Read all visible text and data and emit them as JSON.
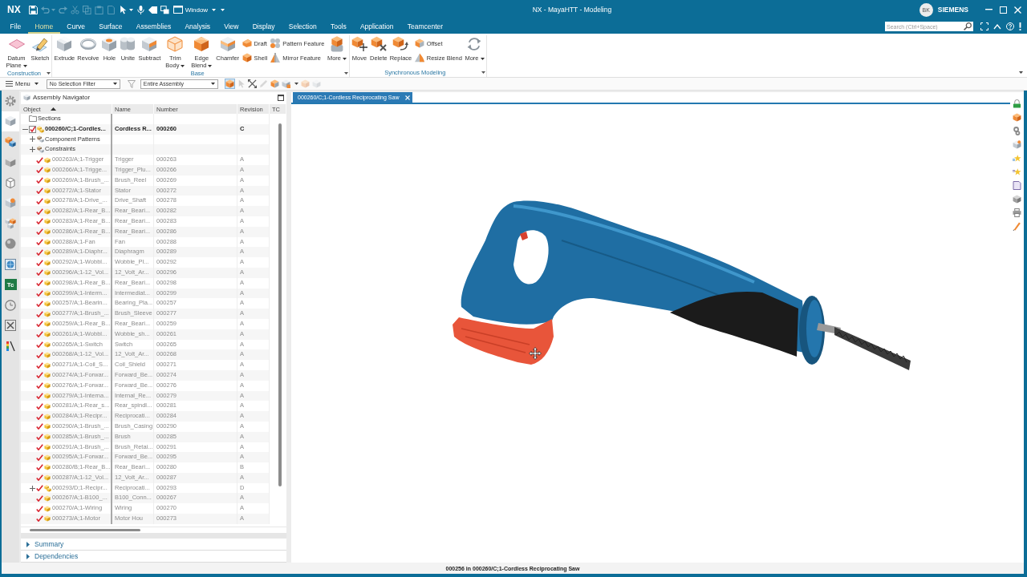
{
  "title_bar": {
    "logo": "NX",
    "quick_access": [
      {
        "disabled": false,
        "dropdown": false
      },
      {
        "disabled": true,
        "dropdown": true
      },
      {
        "disabled": true,
        "dropdown": false
      },
      {
        "disabled": true,
        "dropdown": false
      },
      {
        "disabled": true,
        "dropdown": false
      },
      {
        "disabled": true,
        "dropdown": false
      },
      {
        "disabled": true,
        "dropdown": false
      },
      {
        "disabled": false,
        "dropdown": true
      },
      {
        "disabled": false,
        "dropdown": false
      },
      {
        "disabled": false,
        "dropdown": false
      },
      {
        "disabled": false,
        "dropdown": false
      }
    ],
    "window_menu": "Window",
    "title": "NX - MayaHTT - Modeling",
    "user_initials": "BK",
    "brand": "SIEMENS"
  },
  "menu_tabs": [
    {
      "label": "File",
      "selected": false
    },
    {
      "label": "Home",
      "selected": true
    },
    {
      "label": "Curve",
      "selected": false
    },
    {
      "label": "Surface",
      "selected": false
    },
    {
      "label": "Assemblies",
      "selected": false
    },
    {
      "label": "Analysis",
      "selected": false
    },
    {
      "label": "View",
      "selected": false
    },
    {
      "label": "Display",
      "selected": false
    },
    {
      "label": "Selection",
      "selected": false
    },
    {
      "label": "Tools",
      "selected": false
    },
    {
      "label": "Application",
      "selected": false
    },
    {
      "label": "Teamcenter",
      "selected": false
    }
  ],
  "search": {
    "placeholder": "Search (Ctrl+Space)"
  },
  "ribbon": {
    "groups": [
      {
        "label": "Construction",
        "commands": [
          {
            "kind": "large",
            "label": "Datum Plane",
            "dropdown": true
          },
          {
            "kind": "large",
            "label": "Sketch",
            "dropdown": false
          }
        ]
      },
      {
        "label": "Base",
        "commands": [
          {
            "kind": "large",
            "label": "Extrude",
            "dropdown": false
          },
          {
            "kind": "large",
            "label": "Revolve",
            "dropdown": false
          },
          {
            "kind": "large",
            "label": "Hole",
            "dropdown": false
          },
          {
            "kind": "large",
            "label": "Unite",
            "dropdown": false
          },
          {
            "kind": "large",
            "label": "Subtract",
            "dropdown": false
          },
          {
            "kind": "large",
            "label": "Trim Body",
            "dropdown": true
          },
          {
            "kind": "large",
            "label": "Edge Blend",
            "dropdown": true
          },
          {
            "kind": "large",
            "label": "Chamfer",
            "dropdown": false
          },
          {
            "kind": "stack",
            "items": [
              {
                "label": "Draft"
              },
              {
                "label": "Shell"
              }
            ]
          },
          {
            "kind": "stack",
            "items": [
              {
                "label": "Pattern Feature"
              },
              {
                "label": "Mirror Feature"
              }
            ]
          },
          {
            "kind": "large",
            "label": "More",
            "dropdown": true
          }
        ]
      },
      {
        "label": "Synchronous Modeling",
        "commands": [
          {
            "kind": "large",
            "label": "Move",
            "dropdown": false
          },
          {
            "kind": "large",
            "label": "Delete",
            "dropdown": false
          },
          {
            "kind": "large",
            "label": "Replace",
            "dropdown": false
          },
          {
            "kind": "stack",
            "items": [
              {
                "label": "Offset"
              },
              {
                "label": "Resize Blend"
              }
            ]
          },
          {
            "kind": "large",
            "label": "More",
            "dropdown": true
          }
        ]
      }
    ]
  },
  "toolbar": {
    "menu": "Menu",
    "selection_filter": "No Selection Filter",
    "scope": "Entire Assembly",
    "tools": [
      {
        "selected": true,
        "disabled": false
      },
      {
        "selected": false,
        "disabled": true
      },
      {
        "selected": false,
        "disabled": false
      },
      {
        "selected": false,
        "disabled": true
      },
      {
        "selected": false,
        "disabled": false
      },
      {
        "selected": false,
        "disabled": false
      },
      {
        "selected": false,
        "disabled": true
      },
      {
        "selected": false,
        "disabled": true
      }
    ]
  },
  "resource_bar": [
    {
      "kind": "icon",
      "selected": false
    },
    {
      "kind": "icon",
      "selected": true
    },
    {
      "kind": "icon",
      "selected": false
    },
    {
      "kind": "icon",
      "selected": false
    },
    {
      "kind": "icon",
      "selected": false
    },
    {
      "kind": "icon",
      "selected": false
    },
    {
      "kind": "icon",
      "selected": false
    },
    {
      "kind": "icon",
      "selected": false
    },
    {
      "kind": "icon",
      "selected": false
    },
    {
      "kind": "badge",
      "text": "Tc",
      "selected": false
    },
    {
      "kind": "icon",
      "selected": false
    },
    {
      "kind": "icon",
      "selected": false
    },
    {
      "kind": "icon",
      "selected": false
    }
  ],
  "navigator": {
    "title": "Assembly Navigator",
    "columns": [
      {
        "label": "Object",
        "sorted": true
      },
      {
        "label": "Name",
        "sorted": false
      },
      {
        "label": "Number",
        "sorted": false
      },
      {
        "label": "Revision",
        "sorted": false
      },
      {
        "label": "TC",
        "sorted": false
      }
    ],
    "tree": [
      {
        "kind": "folder",
        "object": "Sections"
      },
      {
        "kind": "assembly",
        "object": "000260/C;1-Cordles...",
        "name": "Cordless R...",
        "number": "000260",
        "revision": "C",
        "checked": true,
        "expanded": true,
        "children": [
          {
            "kind": "group",
            "object": "Component Patterns",
            "expanded": false
          },
          {
            "kind": "group",
            "object": "Constraints",
            "expanded": false
          },
          {
            "kind": "part",
            "object": "000263/A;1-Trigger",
            "name": "Trigger",
            "number": "000263",
            "revision": "A",
            "checked": true
          },
          {
            "kind": "part",
            "object": "000266/A;1-Trigge...",
            "name": "Trigger_Plu...",
            "number": "000266",
            "revision": "A",
            "checked": true
          },
          {
            "kind": "part",
            "object": "000269/A;1-Brush_...",
            "name": "Brush_Reel",
            "number": "000269",
            "revision": "A",
            "checked": true
          },
          {
            "kind": "part",
            "object": "000272/A;1-Stator",
            "name": "Stator",
            "number": "000272",
            "revision": "A",
            "checked": true
          },
          {
            "kind": "part",
            "object": "000278/A;1-Drive_...",
            "name": "Drive_Shaft",
            "number": "000278",
            "revision": "A",
            "checked": true
          },
          {
            "kind": "part",
            "object": "000282/A;1-Rear_B...",
            "name": "Rear_Beari...",
            "number": "000282",
            "revision": "A",
            "checked": true
          },
          {
            "kind": "part",
            "object": "000283/A;1-Rear_B...",
            "name": "Rear_Beari...",
            "number": "000283",
            "revision": "A",
            "checked": true
          },
          {
            "kind": "part",
            "object": "000286/A;1-Rear_B...",
            "name": "Rear_Beari...",
            "number": "000286",
            "revision": "A",
            "checked": true
          },
          {
            "kind": "part",
            "object": "000288/A;1-Fan",
            "name": "Fan",
            "number": "000288",
            "revision": "A",
            "checked": true
          },
          {
            "kind": "part",
            "object": "000289/A;1-Diaphr...",
            "name": "Diaphragm",
            "number": "000289",
            "revision": "A",
            "checked": true
          },
          {
            "kind": "part",
            "object": "000292/A;1-Wobbl...",
            "name": "Wobble_Pl...",
            "number": "000292",
            "revision": "A",
            "checked": true
          },
          {
            "kind": "part",
            "object": "000296/A;1-12_Vol...",
            "name": "12_Volt_Ar...",
            "number": "000296",
            "revision": "A",
            "checked": true
          },
          {
            "kind": "part",
            "object": "000298/A;1-Rear_B...",
            "name": "Rear_Beari...",
            "number": "000298",
            "revision": "A",
            "checked": true
          },
          {
            "kind": "part",
            "object": "000299/A;1-Interm...",
            "name": "Intermediat...",
            "number": "000299",
            "revision": "A",
            "checked": true
          },
          {
            "kind": "part",
            "object": "000257/A;1-Bearin...",
            "name": "Bearing_Pla...",
            "number": "000257",
            "revision": "A",
            "checked": true
          },
          {
            "kind": "part",
            "object": "000277/A;1-Brush_...",
            "name": "Brush_Sleeve",
            "number": "000277",
            "revision": "A",
            "checked": true
          },
          {
            "kind": "part",
            "object": "000259/A;1-Rear_B...",
            "name": "Rear_Beari...",
            "number": "000259",
            "revision": "A",
            "checked": true
          },
          {
            "kind": "part",
            "object": "000261/A;1-Wobbl...",
            "name": "Wobble_sh...",
            "number": "000261",
            "revision": "A",
            "checked": true
          },
          {
            "kind": "part",
            "object": "000265/A;1-Switch",
            "name": "Switch",
            "number": "000265",
            "revision": "A",
            "checked": true
          },
          {
            "kind": "part",
            "object": "000268/A;1-12_Vol...",
            "name": "12_Volt_Ar...",
            "number": "000268",
            "revision": "A",
            "checked": true
          },
          {
            "kind": "part",
            "object": "000271/A;1-Coil_S...",
            "name": "Coil_Shield",
            "number": "000271",
            "revision": "A",
            "checked": true
          },
          {
            "kind": "part",
            "object": "000274/A;1-Forwar...",
            "name": "Forward_Be...",
            "number": "000274",
            "revision": "A",
            "checked": true
          },
          {
            "kind": "part",
            "object": "000276/A;1-Forwar...",
            "name": "Forward_Be...",
            "number": "000276",
            "revision": "A",
            "checked": true
          },
          {
            "kind": "part",
            "object": "000279/A;1-Interna...",
            "name": "Internal_Re...",
            "number": "000279",
            "revision": "A",
            "checked": true
          },
          {
            "kind": "part",
            "object": "000281/A;1-Rear_s...",
            "name": "Rear_spindl...",
            "number": "000281",
            "revision": "A",
            "checked": true
          },
          {
            "kind": "part",
            "object": "000284/A;1-Recipr...",
            "name": "Reciprocati...",
            "number": "000284",
            "revision": "A",
            "checked": true
          },
          {
            "kind": "part",
            "object": "000290/A;1-Brush_...",
            "name": "Brush_Casing",
            "number": "000290",
            "revision": "A",
            "checked": true
          },
          {
            "kind": "part",
            "object": "000285/A;1-Brush_...",
            "name": "Brush",
            "number": "000285",
            "revision": "A",
            "checked": true
          },
          {
            "kind": "part",
            "object": "000291/A;1-Brush_...",
            "name": "Brush_Retai...",
            "number": "000291",
            "revision": "A",
            "checked": true
          },
          {
            "kind": "part",
            "object": "000295/A;1-Forwar...",
            "name": "Forward_Be...",
            "number": "000295",
            "revision": "A",
            "checked": true
          },
          {
            "kind": "part",
            "object": "000280/B;1-Rear_B...",
            "name": "Rear_Beari...",
            "number": "000280",
            "revision": "B",
            "checked": true
          },
          {
            "kind": "part",
            "object": "000287/A;1-12_Vol...",
            "name": "12_Volt_Ar...",
            "number": "000287",
            "revision": "A",
            "checked": true
          },
          {
            "kind": "subassembly",
            "object": "000293/D;1-Recipr...",
            "name": "Reciprocati...",
            "number": "000293",
            "revision": "D",
            "checked": true,
            "expanded": false
          },
          {
            "kind": "part",
            "object": "000267/A;1-B100_...",
            "name": "B100_Conn...",
            "number": "000267",
            "revision": "A",
            "checked": true
          },
          {
            "kind": "part",
            "object": "000270/A;1-Wiring",
            "name": "Wiring",
            "number": "000270",
            "revision": "A",
            "checked": true
          },
          {
            "kind": "part",
            "object": "000273/A;1-Motor",
            "name": "Motor Hou",
            "number": "000273",
            "revision": "A",
            "checked": true
          }
        ]
      }
    ],
    "panels": [
      {
        "label": "Summary",
        "expanded": false
      },
      {
        "label": "Dependencies",
        "expanded": false
      }
    ]
  },
  "graphics": {
    "tab": "000260/C;1-Cordless Reciprocating Saw"
  },
  "status_bar": {
    "message": "000256 in 000260/C;1-Cordless Reciprocating Saw"
  }
}
